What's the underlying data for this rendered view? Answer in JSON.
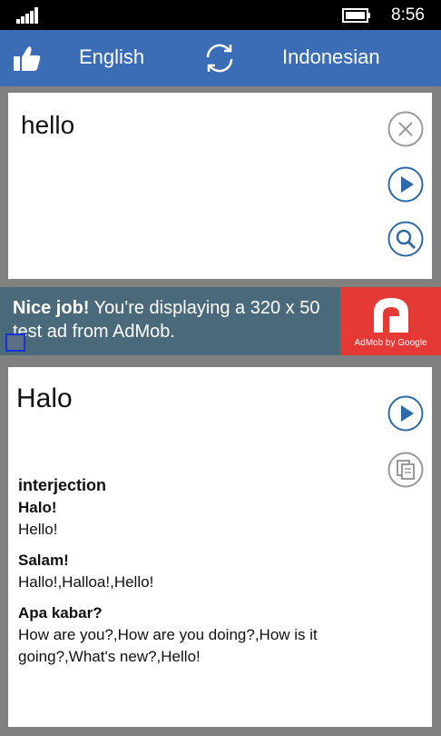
{
  "status": {
    "time": "8:56"
  },
  "lang_bar": {
    "source": "English",
    "target": "Indonesian"
  },
  "input": {
    "text": "hello"
  },
  "ad": {
    "headline": "Nice job!",
    "body": " You're displaying a 320 x 50 test ad from AdMob.",
    "logo_label": "AdMob by Google"
  },
  "result": {
    "word": "Halo",
    "part_of_speech": "interjection",
    "entries": [
      {
        "term": "Halo!",
        "gloss": "Hello!"
      },
      {
        "term": "Salam!",
        "gloss": "Hallo!,Halloa!,Hello!"
      },
      {
        "term": "Apa kabar?",
        "gloss": "How are you?,How are you doing?,How is it going?,What's new?,Hello!"
      }
    ]
  },
  "colors": {
    "accent": "#3b6db6",
    "icon_blue": "#2f6aa8",
    "ad_bg": "#4a6a7c",
    "ad_logo_bg": "#e53935"
  },
  "icons": [
    "signal-icon",
    "battery-icon",
    "like-icon",
    "swap-icon",
    "clear-icon",
    "play-icon",
    "search-icon",
    "copy-icon",
    "admob-logo-icon",
    "ad-info-icon"
  ]
}
